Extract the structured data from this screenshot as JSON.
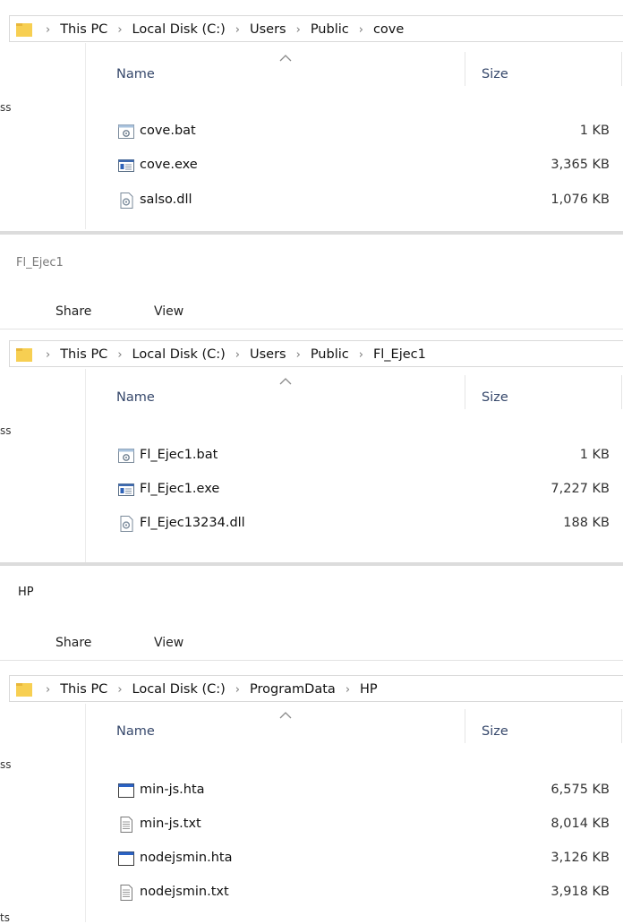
{
  "panels": [
    {
      "title": "",
      "menu": null,
      "breadcrumb": [
        "This PC",
        "Local Disk (C:)",
        "Users",
        "Public",
        "cove"
      ],
      "nav_fragment": "ss",
      "columns": {
        "name": "Name",
        "size": "Size"
      },
      "files": [
        {
          "icon": "bat-file-icon",
          "name": "cove.bat",
          "size": "1 KB"
        },
        {
          "icon": "exe-file-icon",
          "name": "cove.exe",
          "size": "3,365 KB"
        },
        {
          "icon": "dll-file-icon",
          "name": "salso.dll",
          "size": "1,076 KB"
        }
      ]
    },
    {
      "title": "Fl_Ejec1",
      "menu": {
        "share": "Share",
        "view": "View"
      },
      "breadcrumb": [
        "This PC",
        "Local Disk (C:)",
        "Users",
        "Public",
        "Fl_Ejec1"
      ],
      "nav_fragment": "ss",
      "columns": {
        "name": "Name",
        "size": "Size"
      },
      "files": [
        {
          "icon": "bat-file-icon",
          "name": "Fl_Ejec1.bat",
          "size": "1 KB"
        },
        {
          "icon": "exe-file-icon",
          "name": "Fl_Ejec1.exe",
          "size": "7,227 KB"
        },
        {
          "icon": "dll-file-icon",
          "name": "Fl_Ejec13234.dll",
          "size": "188 KB"
        }
      ]
    },
    {
      "title": "HP",
      "menu": {
        "share": "Share",
        "view": "View"
      },
      "breadcrumb": [
        "This PC",
        "Local Disk (C:)",
        "ProgramData",
        "HP"
      ],
      "nav_fragment": "ss",
      "nav_fragment_bottom": "ts",
      "columns": {
        "name": "Name",
        "size": "Size"
      },
      "files": [
        {
          "icon": "hta-file-icon",
          "name": "min-js.hta",
          "size": "6,575 KB"
        },
        {
          "icon": "txt-file-icon",
          "name": "min-js.txt",
          "size": "8,014 KB"
        },
        {
          "icon": "hta-file-icon",
          "name": "nodejsmin.hta",
          "size": "3,126 KB"
        },
        {
          "icon": "txt-file-icon",
          "name": "nodejsmin.txt",
          "size": "3,918 KB"
        }
      ]
    }
  ]
}
